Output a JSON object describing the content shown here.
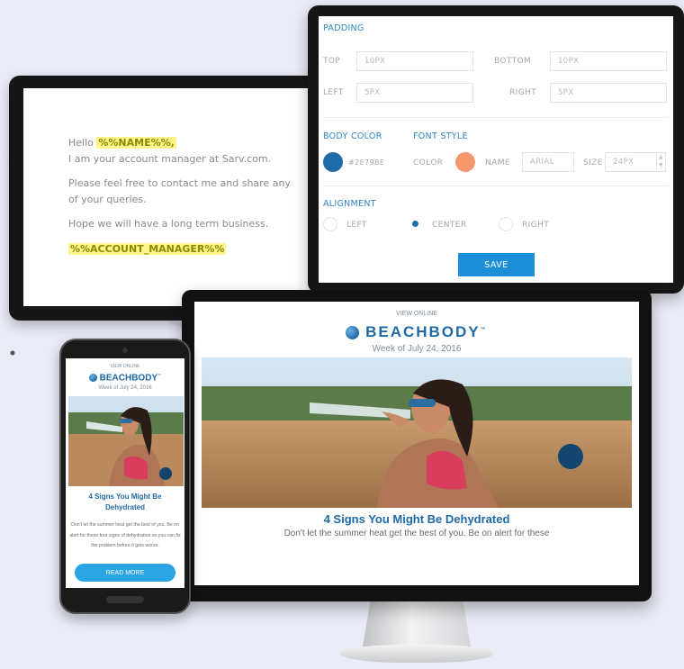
{
  "email": {
    "greeting": "Hello",
    "name_token": "%%NAME%%,",
    "line1": "I am your account manager at Sarv.com.",
    "line2": "Please feel free to contact me and share any of your queries.",
    "line3": "Hope we will have a long term business.",
    "signature_token": "%%ACCOUNT_MANAGER%%"
  },
  "settings": {
    "padding_title": "PADDING",
    "top_label": "TOP",
    "top_value": "10PX",
    "bottom_label": "BOTTOM",
    "bottom_value": "10PX",
    "left_label": "LEFT",
    "left_value": "5PX",
    "right_label": "RIGHT",
    "right_value": "5PX",
    "body_color_title": "BODY COLOR",
    "body_color_value": "#2E79BE",
    "body_color_hex": "#1f6aa9",
    "font_style_title": "FONT STYLE",
    "color_label": "COLOR",
    "font_color_hex": "#f4976c",
    "name_label": "NAME",
    "name_value": "ARIAL",
    "size_label": "SIZE",
    "size_value": "24PX",
    "alignment_title": "ALIGNMENT",
    "align_left": "LEFT",
    "align_center": "CENTER",
    "align_right": "RIGHT",
    "selected_alignment": "CENTER",
    "save_label": "SAVE"
  },
  "newsletter": {
    "view_online": "VIEW ONLINE",
    "brand": "BEACHBODY",
    "trademark": "™",
    "week": "Week of July 24, 2016",
    "headline": "4 Signs You Might Be Dehydrated",
    "body": "Don't let the summer heat get the best of you. Be on alert for these four signs of dehydration so you can fix the problem before it gets worse.",
    "desktop_body_visible": "Don't let the summer heat get the best of you. Be on alert for these",
    "read_more": "READ MORE"
  }
}
